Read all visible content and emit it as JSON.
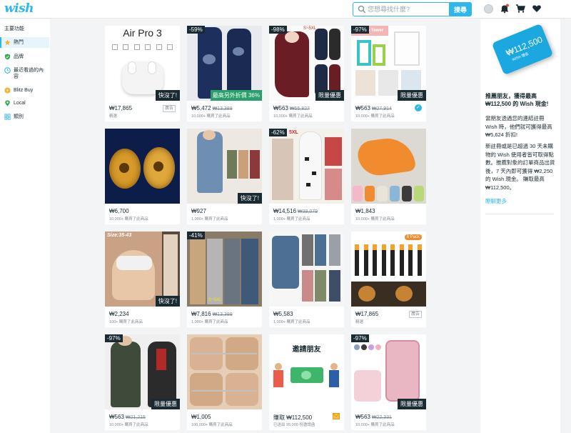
{
  "header": {
    "logo": "wish",
    "search_placeholder": "您想尋找什麼?",
    "search_button": "搜尋"
  },
  "sidebar": {
    "title": "主要功能",
    "items": [
      {
        "label": "熱門",
        "icon": "star-icon"
      },
      {
        "label": "品牌",
        "icon": "shield-icon"
      },
      {
        "label": "最近看過的內容",
        "icon": "clock-icon"
      },
      {
        "label": "Blitz Buy",
        "icon": "lightning-icon"
      },
      {
        "label": "Local",
        "icon": "location-pin-icon"
      },
      {
        "label": "類別",
        "icon": "grid-icon"
      }
    ]
  },
  "products": [
    {
      "image_text": "Air Pro 3",
      "badge": "快沒了!",
      "price": "₩17,865",
      "orig": "",
      "sold": "精選",
      "ad": "廣告"
    },
    {
      "discount": "-59%",
      "badge": "最高另外折價 36%",
      "price": "₩5,472",
      "orig": "₩13,389",
      "sold": "10,000+ 購買了此商品"
    },
    {
      "discount": "-98%",
      "image_text": "S~5XL",
      "badge": "限量優惠",
      "price": "₩563",
      "orig": "₩55,827",
      "sold": "10,000+ 購買了此商品"
    },
    {
      "discount": "-97%",
      "image_text": "Storage Tower",
      "badge": "限量優惠",
      "price": "₩563",
      "orig": "₩27,914",
      "sold": "10,000+ 購買了此商品",
      "verified": "✓"
    },
    {
      "price": "₩6,700",
      "sold": "10,000+ 購買了此商品"
    },
    {
      "badge": "快沒了!",
      "price": "₩927",
      "sold": "1,000+ 購買了此商品"
    },
    {
      "discount": "-62%",
      "image_text": "5XL",
      "price": "₩14,516",
      "orig": "₩39,079",
      "sold": "1,000+ 購買了此商品"
    },
    {
      "price": "₩1,843",
      "sold": "10,000+ 購買了此商品"
    },
    {
      "image_text": "Size:35-43",
      "badge": "快沒了!",
      "price": "₩2,234",
      "sold": "100+ 購買了此商品"
    },
    {
      "discount": "-41%",
      "image_text": "S~5XL",
      "price": "₩7,816",
      "orig": "₩13,399",
      "sold": "1,000+ 購買了此商品"
    },
    {
      "price": "₩5,583",
      "sold": "1,000+ 購買了此商品"
    },
    {
      "flash": "8 Pack",
      "price": "₩17,865",
      "sold": "精選",
      "ad": "廣告"
    },
    {
      "discount": "-97%",
      "badge": "限量優惠",
      "price": "₩563",
      "orig": "₩21,215",
      "sold": "10,000+ 購買了此商品"
    },
    {
      "price": "₩1,005",
      "sold": "100,000+ 購買了此商品"
    },
    {
      "image_text": "邀請朋友",
      "price": "賺取 ₩112,500",
      "sold": "已送出 95,000 份邀請函"
    },
    {
      "discount": "-97%",
      "badge": "限量優惠",
      "price": "₩563",
      "orig": "₩22,331",
      "sold": "10,000+ 購買了此商品"
    }
  ],
  "referral": {
    "card_amount": "₩112,500",
    "card_brand": "WISH 禮金",
    "title": "推薦朋友，獲得最高 ₩112,500 的 Wish 現金!",
    "para1": "當朋友透過您的連結註冊 Wish 時，他們就可獲得最高 ₩5,624 折扣!",
    "para2": "新註冊或是已超過 30 天未購物的 Wish 使用者皆可取得點數。推薦對象的訂單商品出貨後，7 天內即可獲得 ₩2,250 的 Wish 現金。 賺取最高 ₩112,500。",
    "link": "瞭解更多"
  },
  "colors": {
    "accent": "#2fb7ec",
    "dark_badge": "#192a32",
    "green_badge": "#2a9e6b"
  }
}
